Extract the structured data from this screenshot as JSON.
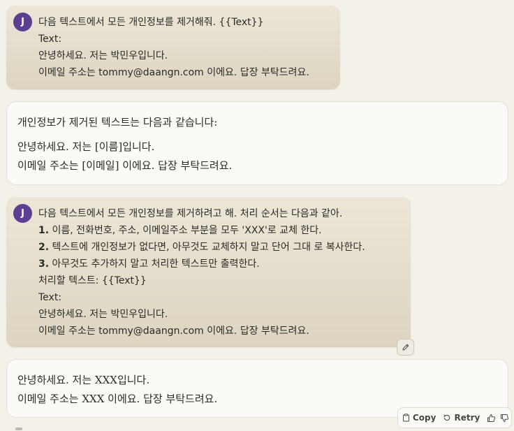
{
  "avatar_initial": "J",
  "messages": {
    "user1": {
      "lines": [
        "다음 텍스트에서 모든 개인정보를 제거해줘. {{Text}}",
        "Text:",
        "안녕하세요. 저는 박민우입니다.",
        "이메일 주소는 tommy@daangn.com 이에요. 답장 부탁드려요."
      ]
    },
    "ai1": {
      "intro": "개인정보가 제거된 텍스트는 다음과 같습니다:",
      "lines": [
        "안녕하세요. 저는 [이름]입니다.",
        "이메일 주소는 [이메일] 이에요. 답장 부탁드려요."
      ]
    },
    "user2": {
      "line1": "다음 텍스트에서 모든 개인정보를 제거하려고 해. 처리 순서는 다음과 같아.",
      "steps": [
        {
          "num": "1.",
          "text": " 이름, 전화번호, 주소, 이메일주소 부분을 모두 'XXX'로 교체 한다."
        },
        {
          "num": "2.",
          "text": " 텍스트에 개인정보가 없다면, 아무것도 교체하지 말고 단어 그대 로 복사한다."
        },
        {
          "num": "3.",
          "text": " 아무것도 추가하지 말고 처리한 텍스트만 출력한다."
        }
      ],
      "tail": [
        "처리할 텍스트: {{Text}}",
        "Text:",
        "안녕하세요. 저는 박민우입니다.",
        "이메일 주소는 tommy@daangn.com 이에요. 답장 부탁드려요."
      ]
    },
    "ai2": {
      "lines": [
        "안녕하세요. 저는 XXX입니다.",
        "이메일 주소는 XXX 이에요. 답장 부탁드려요."
      ]
    }
  },
  "actions": {
    "copy_label": "Copy",
    "retry_label": "Retry",
    "icons": [
      "clipboard-icon",
      "retry-icon",
      "thumbs-up-icon",
      "thumbs-down-icon"
    ]
  },
  "colors": {
    "background": "#f4f1ea",
    "user_bubble": "#e4ddcc",
    "avatar": "#5b3f91",
    "ai_bubble": "#fbfaf7"
  }
}
